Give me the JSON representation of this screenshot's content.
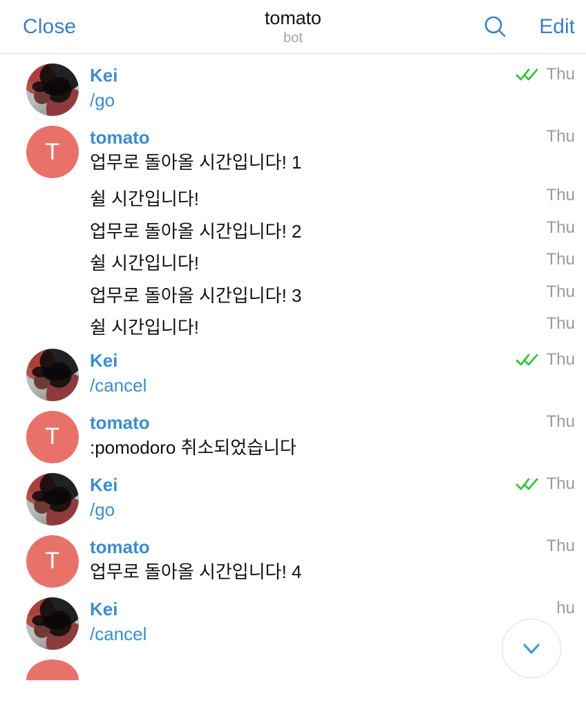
{
  "header": {
    "close_label": "Close",
    "title": "tomato",
    "subtitle": "bot",
    "edit_label": "Edit",
    "search_icon": "search-icon"
  },
  "colors": {
    "accent_blue": "#3a7fc1",
    "sender_blue": "#3a8dd0",
    "bot_avatar": "#e8726a",
    "tick_green": "#34c23a",
    "time_gray": "#9a9a9a",
    "text_black": "#101010"
  },
  "messages": [
    {
      "sender": "Kei",
      "avatar_type": "photo",
      "group_start": true,
      "text": "/go",
      "is_command": true,
      "time": "Thu",
      "ticks": "double-check-icon"
    },
    {
      "sender": "tomato",
      "avatar_type": "letter",
      "avatar_letter": "T",
      "group_start": true,
      "text": "업무로 돌아올 시간입니다! 1",
      "is_command": false,
      "time": "Thu",
      "ticks": null
    },
    {
      "sender": null,
      "group_start": false,
      "text": "쉴 시간입니다!",
      "is_command": false,
      "time": "Thu",
      "ticks": null
    },
    {
      "sender": null,
      "group_start": false,
      "text": "업무로 돌아올 시간입니다! 2",
      "is_command": false,
      "time": "Thu",
      "ticks": null
    },
    {
      "sender": null,
      "group_start": false,
      "text": "쉴 시간입니다!",
      "is_command": false,
      "time": "Thu",
      "ticks": null
    },
    {
      "sender": null,
      "group_start": false,
      "text": "업무로 돌아올 시간입니다! 3",
      "is_command": false,
      "time": "Thu",
      "ticks": null
    },
    {
      "sender": null,
      "group_start": false,
      "text": "쉴 시간입니다!",
      "is_command": false,
      "time": "Thu",
      "ticks": null
    },
    {
      "sender": "Kei",
      "avatar_type": "photo",
      "group_start": true,
      "text": "/cancel",
      "is_command": true,
      "time": "Thu",
      "ticks": "double-check-icon"
    },
    {
      "sender": "tomato",
      "avatar_type": "letter",
      "avatar_letter": "T",
      "group_start": true,
      "text": ":pomodoro 취소되었습니다",
      "is_command": false,
      "time": "Thu",
      "ticks": null
    },
    {
      "sender": "Kei",
      "avatar_type": "photo",
      "group_start": true,
      "text": "/go",
      "is_command": true,
      "time": "Thu",
      "ticks": "double-check-icon"
    },
    {
      "sender": "tomato",
      "avatar_type": "letter",
      "avatar_letter": "T",
      "group_start": true,
      "text": "업무로 돌아올 시간입니다! 4",
      "is_command": false,
      "time": "Thu",
      "ticks": null
    },
    {
      "sender": "Kei",
      "avatar_type": "photo",
      "group_start": true,
      "text": "/cancel",
      "is_command": true,
      "time": "hu",
      "ticks": null
    }
  ],
  "scroll_button": {
    "icon": "chevron-down-icon"
  }
}
